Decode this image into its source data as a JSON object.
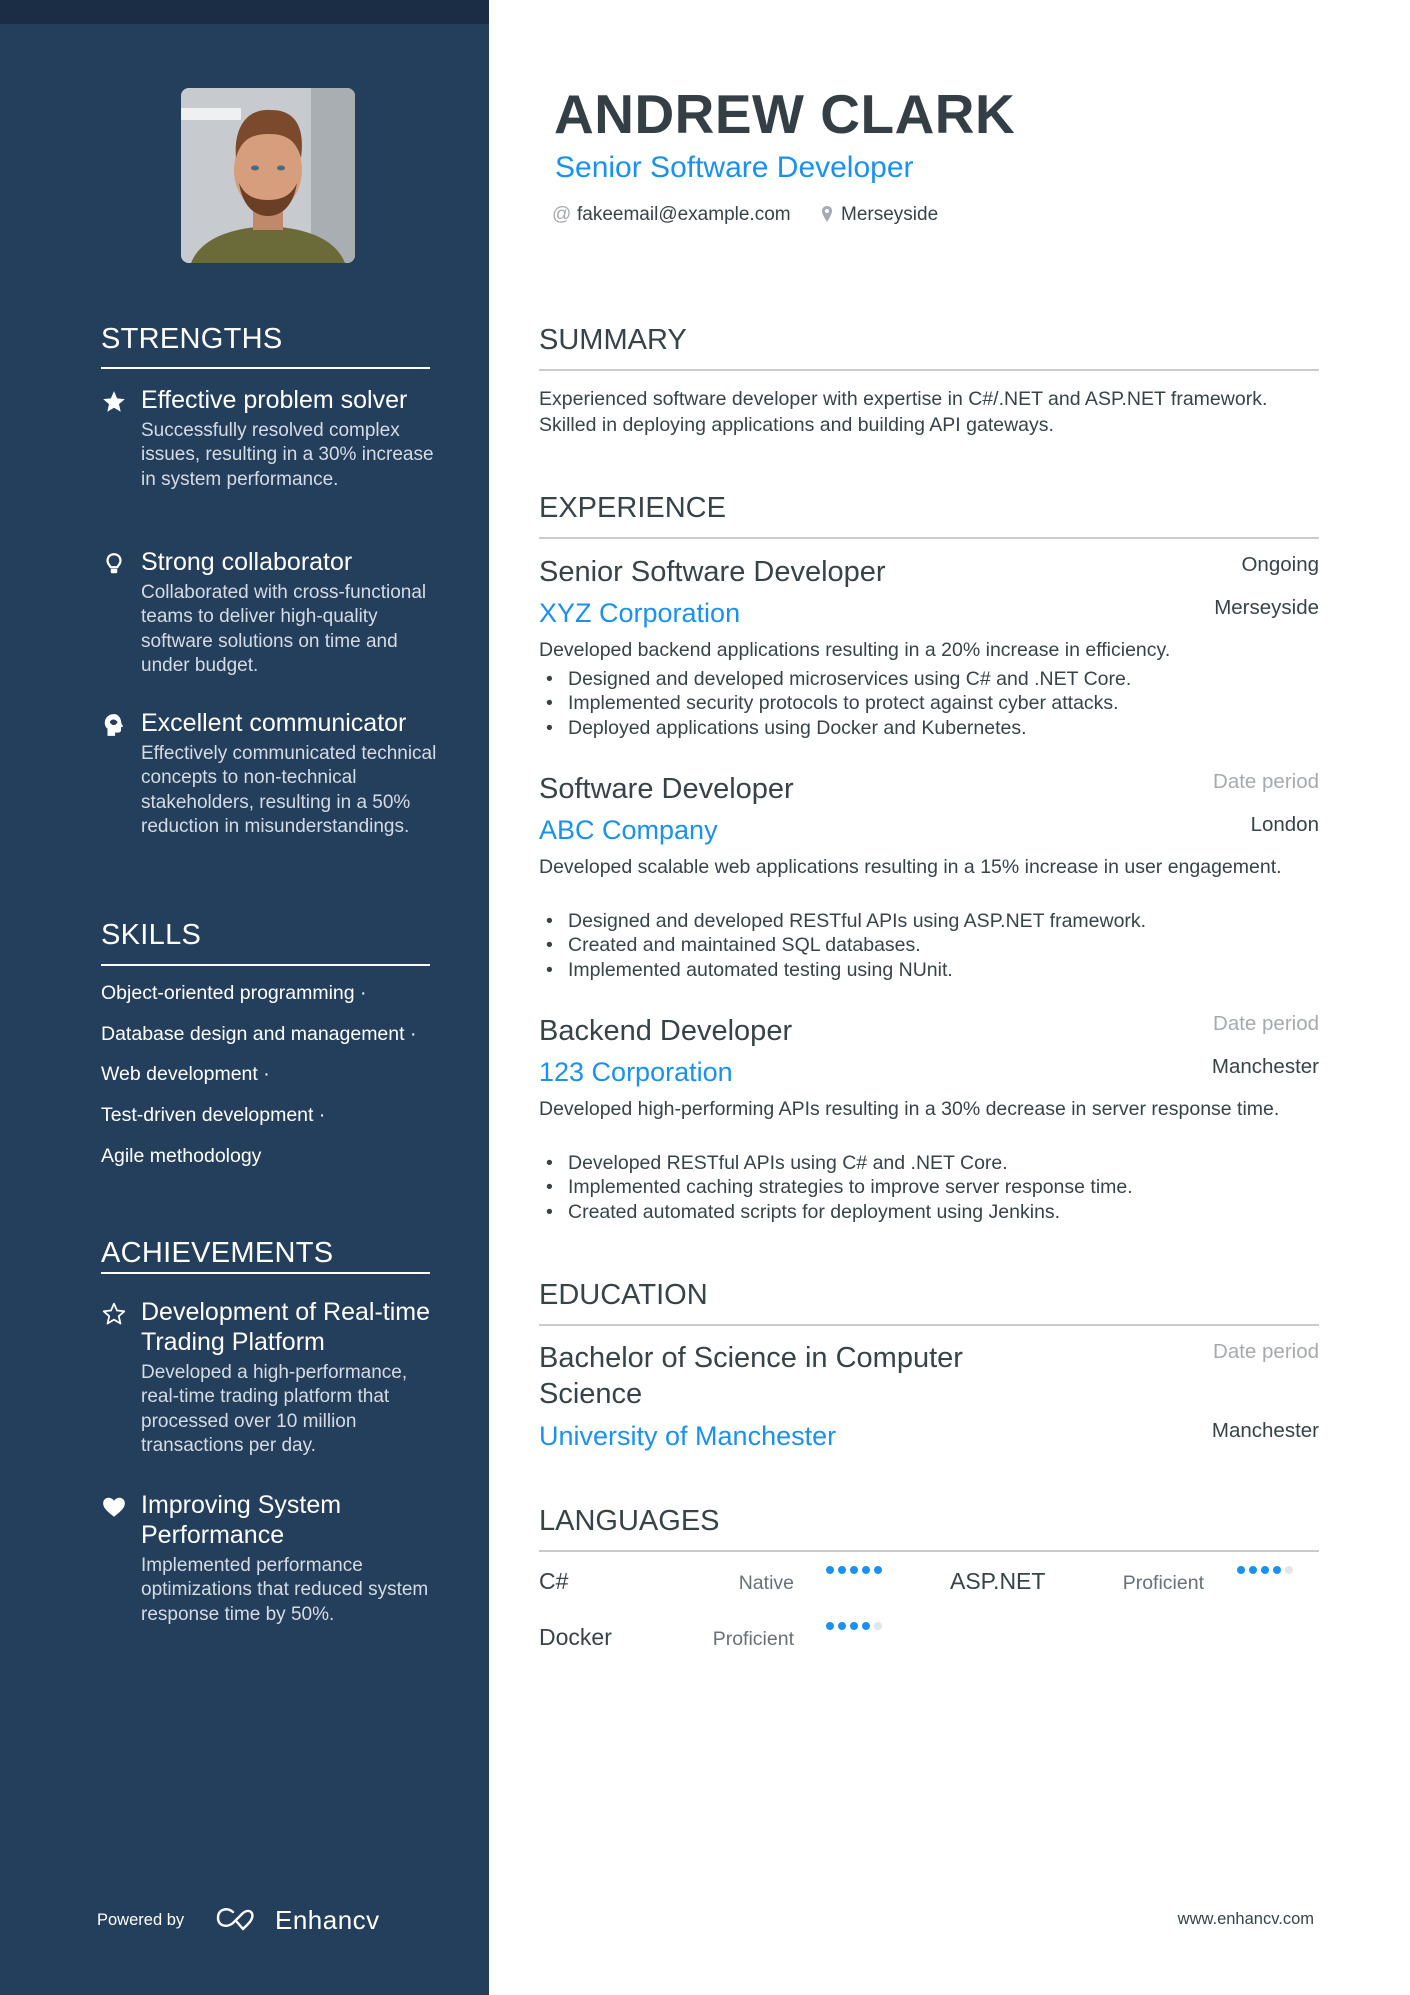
{
  "profile": {
    "name": "ANDREW CLARK",
    "title": "Senior Software Developer",
    "email": "fakeemail@example.com",
    "location": "Merseyside",
    "email_icon": "at-sign-icon",
    "location_icon": "map-pin-icon",
    "photo_alt": "Profile photo of Andrew Clark"
  },
  "sidebar": {
    "strengths": {
      "heading": "STRENGTHS",
      "items": [
        {
          "icon": "star-filled-icon",
          "title": "Effective problem solver",
          "description": "Successfully resolved complex issues, resulting in a 30% increase in system performance."
        },
        {
          "icon": "lightbulb-icon",
          "title": "Strong collaborator",
          "description": "Collaborated with cross-functional teams to deliver high-quality software solutions on time and under budget."
        },
        {
          "icon": "head-brain-icon",
          "title": "Excellent communicator",
          "description": "Effectively communicated technical concepts to non-technical stakeholders, resulting in a 50% reduction in misunderstandings."
        }
      ]
    },
    "skills": {
      "heading": "SKILLS",
      "items": [
        "Object-oriented programming ·",
        "Database design and management ·",
        "Web development ·",
        "Test-driven development ·",
        "Agile methodology"
      ]
    },
    "achievements": {
      "heading": "ACHIEVEMENTS",
      "items": [
        {
          "icon": "star-outline-icon",
          "title": "Development of Real-time Trading Platform",
          "description": "Developed a high-performance, real-time trading platform that processed over 10 million transactions per day."
        },
        {
          "icon": "heart-icon",
          "title": "Improving System Performance",
          "description": "Implemented performance optimizations that reduced system response time by 50%."
        }
      ]
    },
    "footer": {
      "powered_by": "Powered by",
      "brand": "Enhancv"
    }
  },
  "main": {
    "summary": {
      "heading": "SUMMARY",
      "text": "Experienced software developer with expertise in C#/.NET and ASP.NET framework. Skilled in deploying applications and building API gateways."
    },
    "experience": {
      "heading": "EXPERIENCE",
      "jobs": [
        {
          "role": "Senior Software Developer",
          "company": "XYZ Corporation",
          "date": "Ongoing",
          "location": "Merseyside",
          "description": "Developed backend applications resulting in a 20% increase in efficiency.",
          "bullets": [
            "Designed and developed microservices using C# and .NET Core.",
            "Implemented security protocols to protect against cyber attacks.",
            "Deployed applications using Docker and Kubernetes."
          ]
        },
        {
          "role": "Software Developer",
          "company": "ABC Company",
          "date": "Date period",
          "location": "London",
          "description": "Developed scalable web applications resulting in a 15% increase in user engagement.",
          "bullets": [
            "Designed and developed RESTful APIs using ASP.NET framework.",
            "Created and maintained SQL databases.",
            "Implemented automated testing using NUnit."
          ]
        },
        {
          "role": "Backend Developer",
          "company": "123 Corporation",
          "date": "Date period",
          "location": "Manchester",
          "description": "Developed high-performing APIs resulting in a 30% decrease in server response time.",
          "bullets": [
            "Developed RESTful APIs using C# and .NET Core.",
            "Implemented caching strategies to improve server response time.",
            "Created automated scripts for deployment using Jenkins."
          ]
        }
      ]
    },
    "education": {
      "heading": "EDUCATION",
      "items": [
        {
          "degree": "Bachelor of Science in Computer Science",
          "school": "University of Manchester",
          "date": "Date period",
          "location": "Manchester"
        }
      ]
    },
    "languages": {
      "heading": "LANGUAGES",
      "items": [
        {
          "name": "C#",
          "level": "Native",
          "rating": 5,
          "max": 5
        },
        {
          "name": "ASP.NET",
          "level": "Proficient",
          "rating": 4,
          "max": 5
        },
        {
          "name": "Docker",
          "level": "Proficient",
          "rating": 4,
          "max": 5
        }
      ]
    },
    "footer": {
      "website": "www.enhancv.com"
    }
  },
  "colors": {
    "sidebar": "#243f5c",
    "sidebar_topbar": "#1b2d44",
    "accent": "#1a91f0",
    "text": "#384347",
    "muted": "#a7aaad",
    "rule": "#c9cbcd"
  }
}
